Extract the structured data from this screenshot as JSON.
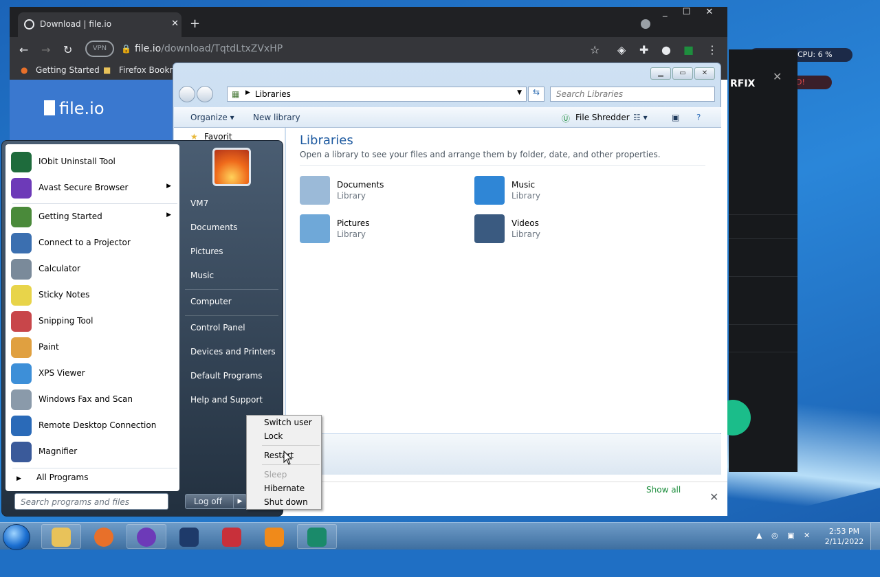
{
  "browser": {
    "tab_title": "Download | file.io",
    "url_host": "file.io",
    "url_path": "/download/TqtdLtxZVxHP",
    "vpn_label": "VPN",
    "bookmarks": [
      "Getting Started",
      "Firefox Bookm"
    ],
    "site_logo": "file.io",
    "show_all": "Show all",
    "window_controls": "_ ☐ ✕"
  },
  "background_app": {
    "cpu": "CPU: 6 %",
    "brand": "RFIX",
    "status": "D!",
    "close": "✕"
  },
  "explorer": {
    "breadcrumb": "Libraries",
    "search_placeholder": "Search Libraries",
    "commands": {
      "organize": "Organize",
      "new_library": "New library",
      "file_shredder": "File Shredder"
    },
    "nav_partial": "Favorit",
    "title": "Libraries",
    "description": "Open a library to see your files and arrange them by folder, date, and other properties.",
    "libraries": [
      {
        "name": "Documents",
        "type": "Library",
        "icon": "documents-icon",
        "color": "#9bbad8"
      },
      {
        "name": "Music",
        "type": "Library",
        "icon": "music-icon",
        "color": "#2f86d6"
      },
      {
        "name": "Pictures",
        "type": "Library",
        "icon": "pictures-icon",
        "color": "#6fa8d8"
      },
      {
        "name": "Videos",
        "type": "Library",
        "icon": "videos-icon",
        "color": "#3a5a80"
      }
    ]
  },
  "start_menu": {
    "programs": [
      {
        "label": "IObit Uninstall Tool",
        "icon": "iobit-icon",
        "color": "#1e6b3c",
        "submenu": false
      },
      {
        "label": "Avast Secure Browser",
        "icon": "avast-browser-icon",
        "color": "#6d3ab8",
        "submenu": true
      },
      {
        "label": "Getting Started",
        "icon": "getting-started-icon",
        "color": "#4a8a3a",
        "submenu": true
      },
      {
        "label": "Connect to a Projector",
        "icon": "projector-icon",
        "color": "#3b6fb0",
        "submenu": false
      },
      {
        "label": "Calculator",
        "icon": "calculator-icon",
        "color": "#7a8a9a",
        "submenu": false
      },
      {
        "label": "Sticky Notes",
        "icon": "sticky-notes-icon",
        "color": "#e8d44a",
        "submenu": false
      },
      {
        "label": "Snipping Tool",
        "icon": "snipping-tool-icon",
        "color": "#c8464a",
        "submenu": false
      },
      {
        "label": "Paint",
        "icon": "paint-icon",
        "color": "#e0a040",
        "submenu": false
      },
      {
        "label": "XPS Viewer",
        "icon": "xps-viewer-icon",
        "color": "#3d8fd8",
        "submenu": false
      },
      {
        "label": "Windows Fax and Scan",
        "icon": "fax-scan-icon",
        "color": "#8a9aaa",
        "submenu": false
      },
      {
        "label": "Remote Desktop Connection",
        "icon": "remote-desktop-icon",
        "color": "#2a6ab8",
        "submenu": false
      },
      {
        "label": "Magnifier",
        "icon": "magnifier-icon",
        "color": "#3a5a9a",
        "submenu": false
      }
    ],
    "all_programs": "All Programs",
    "search_placeholder": "Search programs and files",
    "right_items": [
      "VM7",
      "Documents",
      "Pictures",
      "Music",
      "Computer",
      "Control Panel",
      "Devices and Printers",
      "Default Programs",
      "Help and Support"
    ],
    "log_off": "Log off"
  },
  "power_menu": {
    "items": [
      {
        "label": "Switch user",
        "enabled": true
      },
      {
        "label": "Lock",
        "enabled": true
      },
      {
        "label": "Restart",
        "enabled": true
      },
      {
        "label": "Sleep",
        "enabled": false
      },
      {
        "label": "Hibernate",
        "enabled": true
      },
      {
        "label": "Shut down",
        "enabled": true
      }
    ]
  },
  "taskbar": {
    "apps": [
      {
        "name": "explorer",
        "icon": "folder-icon",
        "color": "#e8c25a"
      },
      {
        "name": "firefox",
        "icon": "firefox-icon",
        "color": "#e8702a"
      },
      {
        "name": "avast-browser",
        "icon": "avast-browser-icon",
        "color": "#6d3ab8"
      },
      {
        "name": "vpn",
        "icon": "shield-icon",
        "color": "#1e3a6a"
      },
      {
        "name": "recorder",
        "icon": "recorder-icon",
        "color": "#c8303a"
      },
      {
        "name": "vlc",
        "icon": "vlc-icon",
        "color": "#f08a1a"
      },
      {
        "name": "grid-app",
        "icon": "grid-app-icon",
        "color": "#1a8a6a"
      }
    ],
    "time": "2:53 PM",
    "date": "2/11/2022"
  }
}
